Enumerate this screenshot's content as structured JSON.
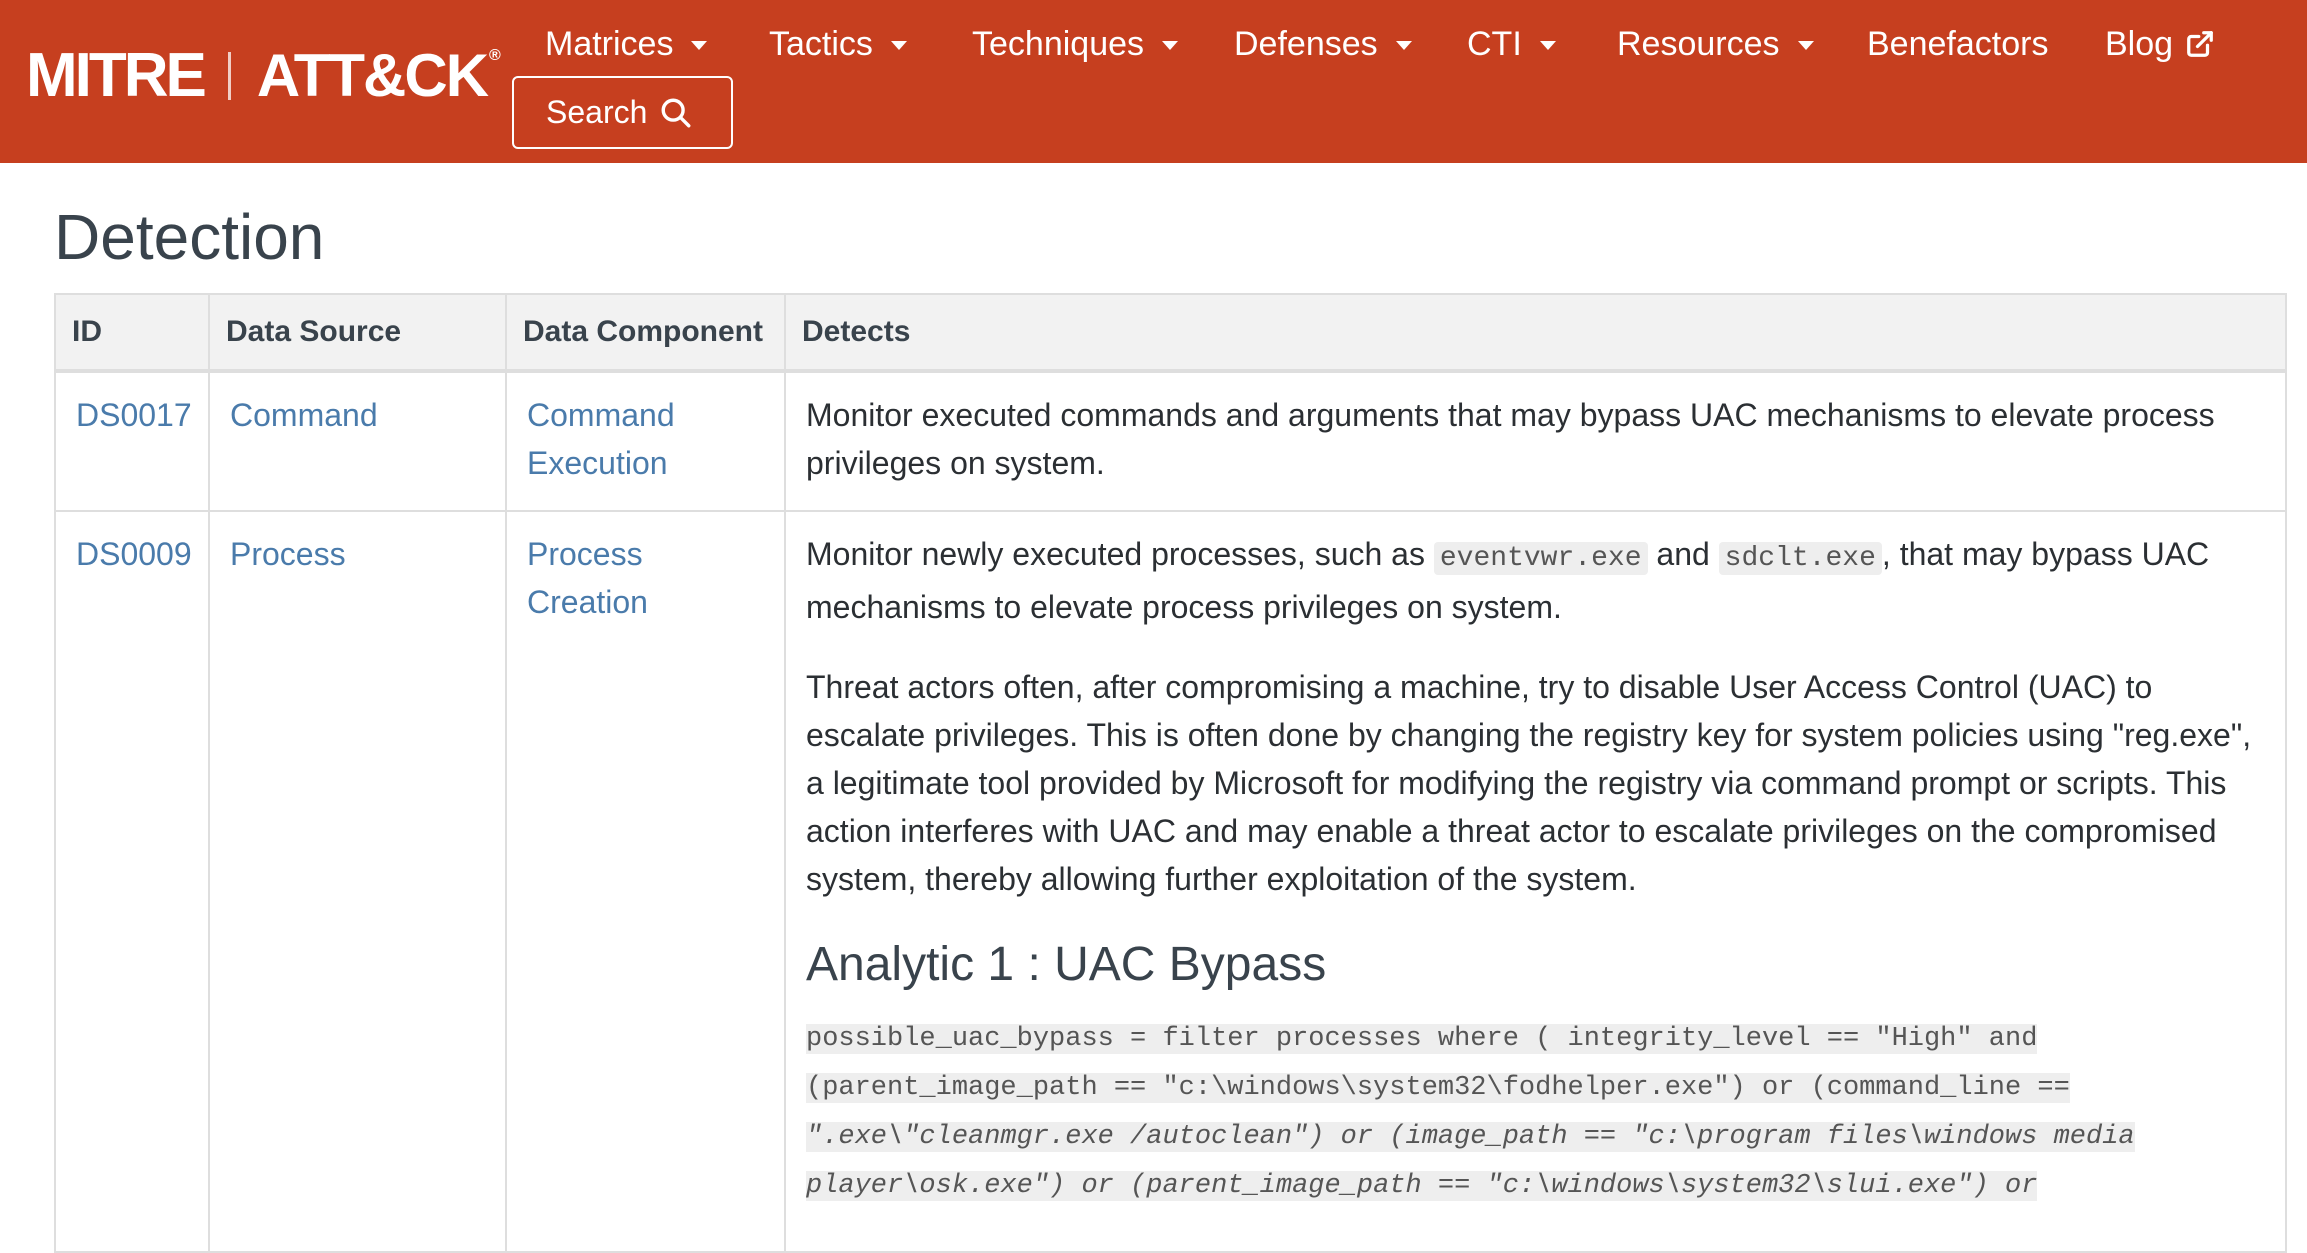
{
  "brand": {
    "left": "MITRE",
    "right": "ATT&CK",
    "reg": "®"
  },
  "nav": {
    "items": [
      {
        "label": "Matrices",
        "dropdown": true
      },
      {
        "label": "Tactics",
        "dropdown": true
      },
      {
        "label": "Techniques",
        "dropdown": true
      },
      {
        "label": "Defenses",
        "dropdown": true
      },
      {
        "label": "CTI",
        "dropdown": true
      },
      {
        "label": "Resources",
        "dropdown": true
      },
      {
        "label": "Benefactors",
        "dropdown": false
      },
      {
        "label": "Blog",
        "dropdown": false,
        "external": true
      }
    ],
    "search_label": "Search"
  },
  "colors": {
    "navbar": "#c63f1f",
    "link": "#4a7bab"
  },
  "page": {
    "title": "Detection"
  },
  "table": {
    "headers": [
      "ID",
      "Data Source",
      "Data Component",
      "Detects"
    ],
    "rows": [
      {
        "id": "DS0017",
        "source": "Command",
        "component": "Command Execution",
        "detects": "Monitor executed commands and arguments that may bypass UAC mechanisms to elevate process privileges on system."
      },
      {
        "id": "DS0009",
        "source": "Process",
        "component": "Process Creation",
        "detects_p1_pre": "Monitor newly executed processes, such as ",
        "detects_p1_code1": "eventvwr.exe",
        "detects_p1_mid": " and ",
        "detects_p1_code2": "sdclt.exe",
        "detects_p1_post": ", that may bypass UAC mechanisms to elevate process privileges on system.",
        "detects_p2": "Threat actors often, after compromising a machine, try to disable User Access Control (UAC) to escalate privileges. This is often done by changing the registry key for system policies using \"reg.exe\", a legitimate tool provided by Microsoft for modifying the registry via command prompt or scripts. This action interferes with UAC and may enable a threat actor to escalate privileges on the compromised system, thereby allowing further exploitation of the system.",
        "analytic_title": "Analytic 1 : UAC Bypass",
        "analytic_code": [
          "possible_uac_bypass = filter processes where ( integrity_level == \"High\" and",
          "(parent_image_path == \"c:\\windows\\system32\\fodhelper.exe\") or (command_line ==",
          "\".exe\\\"cleanmgr.exe /autoclean\") or (image_path == \"c:\\program files\\windows media",
          "player\\osk.exe\") or (parent_image_path == \"c:\\windows\\system32\\slui.exe\") or"
        ]
      }
    ]
  }
}
